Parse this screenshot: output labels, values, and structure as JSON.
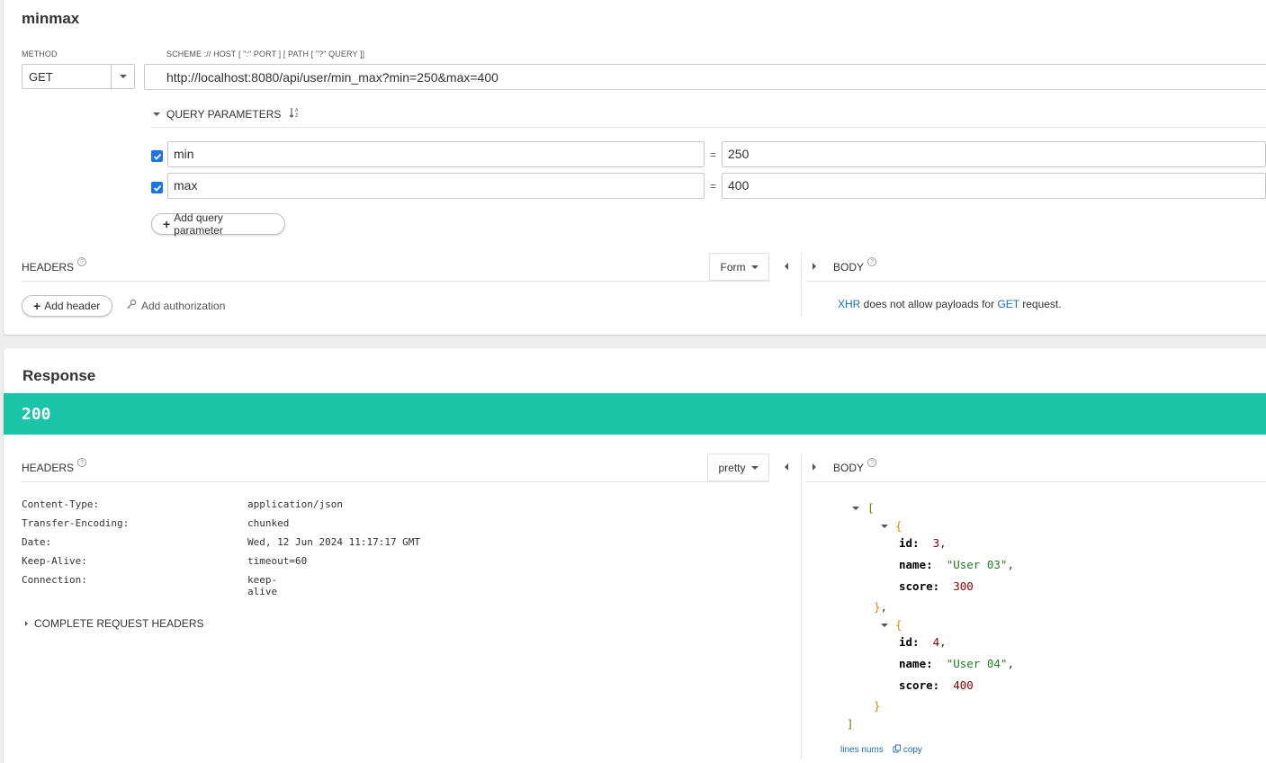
{
  "request": {
    "title": "minmax",
    "method_label": "METHOD",
    "method_value": "GET",
    "url_label": "SCHEME :// HOST [ \":\" PORT ] [ PATH [ \"?\" QUERY ]]",
    "url_value": "http://localhost:8080/api/user/min_max?min=250&max=400",
    "query_params_label": "QUERY PARAMETERS",
    "params": [
      {
        "name": "min",
        "eq": "=",
        "value": "250",
        "checked": true
      },
      {
        "name": "max",
        "eq": "=",
        "value": "400",
        "checked": true
      }
    ],
    "add_query_param_label": "Add query parameter",
    "headers_label": "HEADERS",
    "headers_mode": "Form",
    "add_header_label": "Add header",
    "add_auth_label": "Add authorization",
    "body_label": "BODY",
    "body_msg": {
      "part1": "XHR",
      "part2": " does not allow payloads for ",
      "part3": "GET",
      "part4": " request."
    }
  },
  "response": {
    "title": "Response",
    "status": "200",
    "status_color": "#1ac4a6",
    "headers_label": "HEADERS",
    "headers_mode": "pretty",
    "headers": [
      {
        "name": "Content-Type:",
        "value": "application/json"
      },
      {
        "name": "Transfer-Encoding:",
        "value": "chunked"
      },
      {
        "name": "Date:",
        "value": "Wed, 12 Jun 2024 11:17:17 GMT"
      },
      {
        "name": "Keep-Alive:",
        "value": "timeout=60"
      },
      {
        "name": "Connection:",
        "value": "keep-alive"
      }
    ],
    "complete_headers_label": "COMPLETE REQUEST HEADERS",
    "body_label": "BODY",
    "body": [
      {
        "id": "3",
        "name": "\"User 03\"",
        "score": "300"
      },
      {
        "id": "4",
        "name": "\"User 04\"",
        "score": "400"
      }
    ],
    "json_keys": {
      "id": "id:",
      "name": "name:",
      "score": "score:"
    },
    "lines_nums_label": "lines nums",
    "copy_label": "copy"
  },
  "icons": {
    "sort": "sort-az-icon",
    "help": "help-circle-icon",
    "key": "key-icon",
    "copy": "copy-icon"
  }
}
